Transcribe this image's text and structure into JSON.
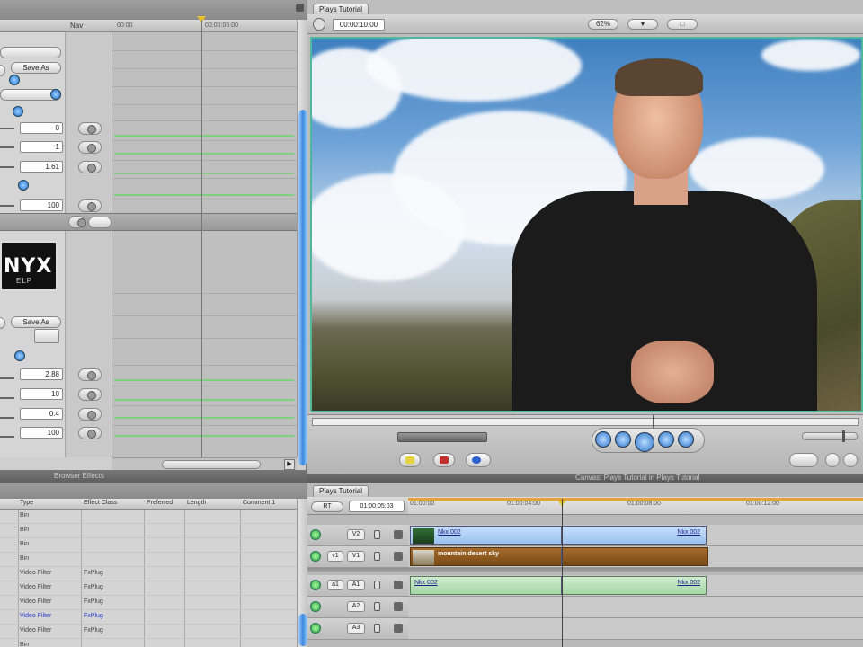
{
  "filters": {
    "nav_label": "Nav",
    "timecode_1": "00:00",
    "timecode_2": "00:00:06:00",
    "save_label": "Save As",
    "save_label_2": "Save As",
    "values": [
      "0",
      "1",
      "1.61",
      "100",
      "2.88",
      "10",
      "0.4",
      "100"
    ],
    "logo_main": "NYX",
    "logo_sub": "ELP",
    "bottom_tab": "Browser  Effects"
  },
  "canvas": {
    "tab": "Plays Tutorial",
    "timecode": "00:00:10:00",
    "zoom_pill": "62%",
    "view_pill": "▼",
    "overlay_pill": "□",
    "footer": "Canvas: Plays Tutorial in Plays Tutorial"
  },
  "browser": {
    "columns": [
      "Type",
      "Effect Class",
      "Preferred",
      "Length",
      "Comment 1"
    ],
    "rows": [
      {
        "type": "Bin",
        "cls": "",
        "sel": false
      },
      {
        "type": "Bin",
        "cls": "",
        "sel": false
      },
      {
        "type": "Bin",
        "cls": "",
        "sel": false
      },
      {
        "type": "Bin",
        "cls": "",
        "sel": false
      },
      {
        "type": "Video Filter",
        "cls": "FxPlug",
        "sel": false
      },
      {
        "type": "Video Filter",
        "cls": "FxPlug",
        "sel": false
      },
      {
        "type": "Video Filter",
        "cls": "FxPlug",
        "sel": false
      },
      {
        "type": "Video Filter",
        "cls": "FxPlug",
        "sel": true
      },
      {
        "type": "Video Filter",
        "cls": "FxPlug",
        "sel": false
      },
      {
        "type": "Bin",
        "cls": "",
        "sel": false
      }
    ]
  },
  "timeline": {
    "tab": "Plays Tutorial",
    "seq_popup": "RT",
    "timecode": "01:00:05:03",
    "ruler": [
      "01:00:00",
      "01:00:04:00",
      "01:00:08:00",
      "01:00:12:00"
    ],
    "tracks": [
      {
        "src": "v1",
        "dst": "V2"
      },
      {
        "src": "v1",
        "dst": "V1"
      },
      {
        "src": "a1",
        "dst": "A1"
      },
      {
        "src": "",
        "dst": "A2"
      },
      {
        "src": "",
        "dst": "A3"
      },
      {
        "src": "",
        "dst": "A4"
      }
    ],
    "clip_v2": "Nkx 002",
    "clip_v2_right": "Nkx 002",
    "clip_v1": "mountain desert sky",
    "clip_a1": "Nkx 002",
    "clip_a1_right": "Nkx 002"
  },
  "colors": {
    "selection_blue": "#3b86dc",
    "keyframe_green": "#7fcf7f",
    "playhead_yellow": "#e6c22b",
    "video_border": "#4fb79b"
  }
}
